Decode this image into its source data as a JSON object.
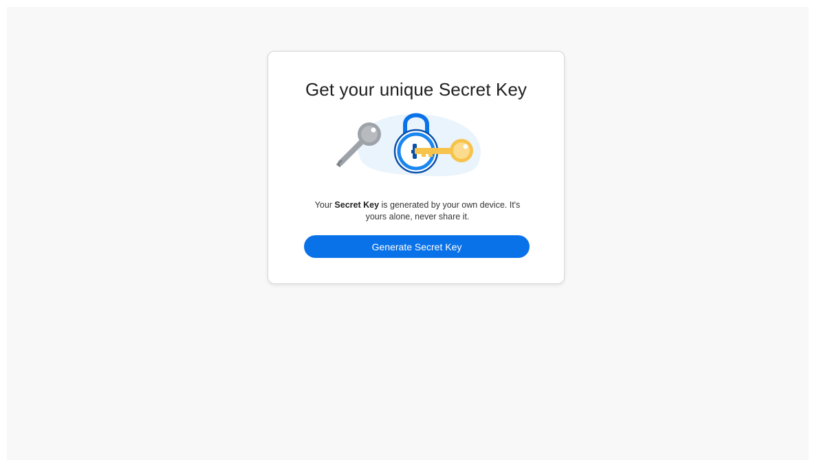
{
  "card": {
    "title": "Get your unique Secret Key",
    "description_prefix": "Your ",
    "description_emphasis": "Secret Key",
    "description_suffix": " is generated by your own device. It's yours alone, never share it.",
    "generate_button_label": "Generate Secret Key"
  },
  "illustration": {
    "icons": [
      "gray-key-icon",
      "padlock-icon",
      "gold-key-icon"
    ]
  },
  "colors": {
    "page_background": "#f8f8f8",
    "card_background": "#ffffff",
    "accent": "#0a72e8",
    "key_gray": "#9ea3a9",
    "key_gold": "#f6c34c",
    "blob": "#eaf4fc"
  }
}
